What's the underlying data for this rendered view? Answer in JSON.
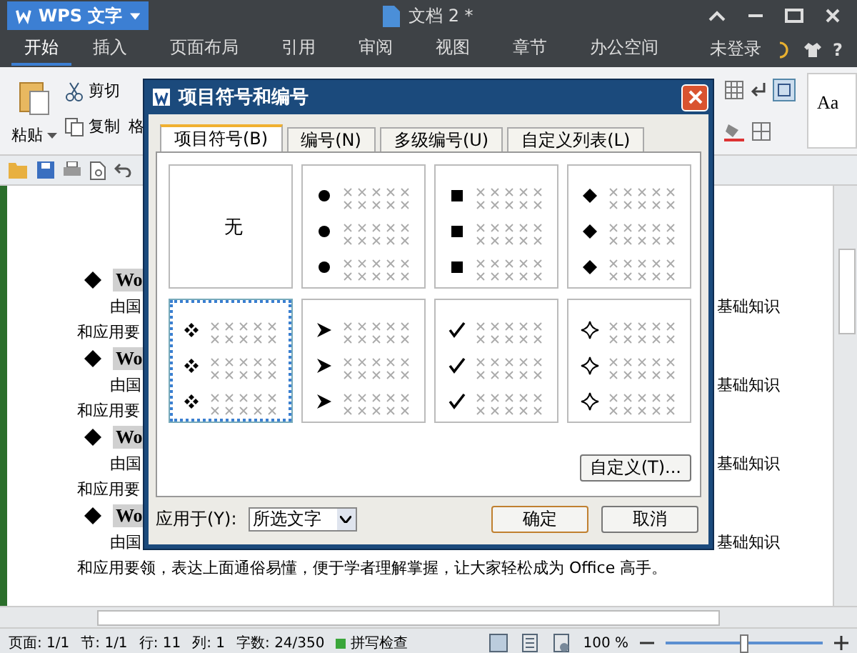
{
  "app_button": {
    "label": "WPS 文字"
  },
  "window": {
    "title": "文档 2 *"
  },
  "tabs": [
    {
      "label": "开始",
      "selected": true
    },
    {
      "label": "插入",
      "selected": false
    },
    {
      "label": "页面布局",
      "selected": false
    },
    {
      "label": "引用",
      "selected": false
    },
    {
      "label": "审阅",
      "selected": false
    },
    {
      "label": "视图",
      "selected": false
    },
    {
      "label": "章节",
      "selected": false
    },
    {
      "label": "办公空间",
      "selected": false
    }
  ],
  "account": {
    "login": "未登录",
    "help": "?"
  },
  "ribbon": {
    "paste": "粘贴",
    "cut": "剪切",
    "copy": "复制",
    "format_painter": "格",
    "style_preview": "Aa"
  },
  "document": {
    "groups": [
      {
        "heading": "Wo",
        "line_1_start": "由国",
        "line_1_end": "基础知识",
        "line_2": "和应用要"
      },
      {
        "heading": "Wo",
        "line_1_start": "由国",
        "line_1_end": "基础知识",
        "line_2": "和应用要"
      },
      {
        "heading": "Wo",
        "line_1_start": "由国",
        "line_1_end": "基础知识",
        "line_2": "和应用要"
      },
      {
        "heading": "Wo",
        "line_1_start": "由国",
        "line_1_end": "基础知识",
        "line_2": "和应用要领，表达上面通俗易懂，便于学者理解掌握，让大家轻松成为 Office 高手。"
      }
    ]
  },
  "dialog": {
    "title": "项目符号和编号",
    "tabs": [
      {
        "label": "项目符号(B)",
        "selected": true
      },
      {
        "label": "编号(N)",
        "selected": false
      },
      {
        "label": "多级编号(U)",
        "selected": false
      },
      {
        "label": "自定义列表(L)",
        "selected": false
      }
    ],
    "styles": [
      {
        "kind": "none",
        "label": "无",
        "selected": false
      },
      {
        "kind": "dot",
        "selected": false
      },
      {
        "kind": "square",
        "selected": false
      },
      {
        "kind": "diamond",
        "selected": false
      },
      {
        "kind": "four-diamond",
        "selected": true
      },
      {
        "kind": "arrow",
        "selected": false
      },
      {
        "kind": "check",
        "selected": false
      },
      {
        "kind": "star",
        "selected": false
      }
    ],
    "customize_button": "自定义(T)...",
    "apply_to_label": "应用于(Y):",
    "apply_to_value": "所选文字",
    "ok_button": "确定",
    "cancel_button": "取消"
  },
  "status_bar": {
    "page": "页面: 1/1",
    "section": "节: 1/1",
    "row": "行: 11",
    "column": "列: 1",
    "word_count": "字数: 24/350",
    "spell_check": "拼写检查",
    "zoom": "100 %",
    "zoom_level": {
      "level": 0.5
    }
  }
}
